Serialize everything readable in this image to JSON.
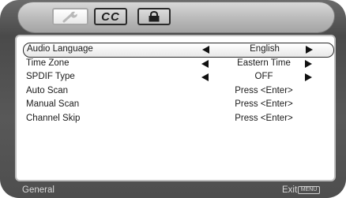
{
  "tabs": {
    "cc_label": "CC"
  },
  "menu": {
    "rows": [
      {
        "label": "Audio Language",
        "value": "English",
        "has_arrows": true,
        "selected": true
      },
      {
        "label": "Time Zone",
        "value": "Eastern Time",
        "has_arrows": true,
        "selected": false
      },
      {
        "label": "SPDIF Type",
        "value": "OFF",
        "has_arrows": true,
        "selected": false
      },
      {
        "label": "Auto Scan",
        "value": "Press <Enter>",
        "has_arrows": false,
        "selected": false
      },
      {
        "label": "Manual Scan",
        "value": "Press <Enter>",
        "has_arrows": false,
        "selected": false
      },
      {
        "label": "Channel Skip",
        "value": "Press <Enter>",
        "has_arrows": false,
        "selected": false
      }
    ]
  },
  "footer": {
    "section": "General",
    "exit_label": "Exit",
    "menu_key": "MENU"
  },
  "colors": {
    "frame": "#555555",
    "panel": "#ffffff",
    "text": "#1a1a1a",
    "footer_text": "#d9d9d9"
  }
}
